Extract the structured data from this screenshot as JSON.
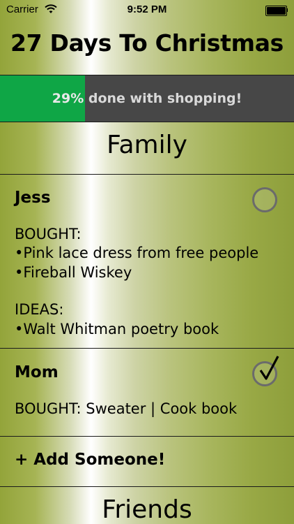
{
  "status_bar": {
    "carrier": "Carrier",
    "time": "9:52 PM"
  },
  "title": "27 Days To Christmas",
  "progress": {
    "percent": 29,
    "percent_text": "29%",
    "label": " done with shopping!",
    "fill_color": "#0fa646",
    "track_color": "#474747"
  },
  "sections": [
    {
      "title": "Family",
      "people": [
        {
          "name": "Jess",
          "checked": false,
          "lines": [
            "BOUGHT:",
            "•Pink lace dress from free people",
            "•Fireball Wiskey",
            "IDEAS:",
            "•Walt Whitman poetry book"
          ]
        },
        {
          "name": "Mom",
          "checked": true,
          "lines": [
            "BOUGHT:  Sweater | Cook book"
          ]
        }
      ],
      "add_label": "+ Add Someone!"
    },
    {
      "title": "Friends"
    }
  ],
  "icons": {
    "wifi": "wifi-icon",
    "battery": "battery-icon",
    "unchecked": "circle-icon",
    "checked": "checkmark-circle-icon"
  }
}
